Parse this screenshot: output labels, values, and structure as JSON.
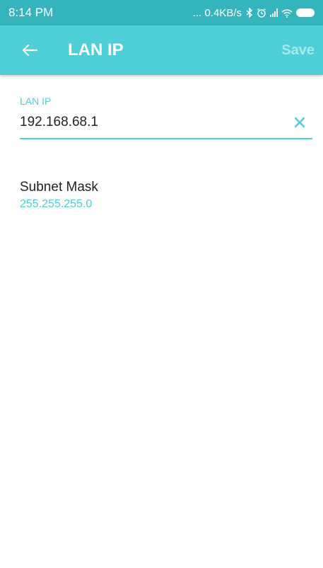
{
  "status_bar": {
    "time": "8:14 PM",
    "network_speed": "... 0.4KB/s",
    "icons": [
      "bluetooth-icon",
      "alarm-icon",
      "signal-icon",
      "wifi-icon",
      "battery-icon"
    ]
  },
  "toolbar": {
    "title": "LAN IP",
    "save_label": "Save",
    "back_icon": "arrow-left-icon"
  },
  "lan_ip_field": {
    "label": "LAN IP",
    "value": "192.168.68.1",
    "clear_icon": "close-icon"
  },
  "subnet_mask": {
    "label": "Subnet Mask",
    "value": "255.255.255.0"
  },
  "colors": {
    "status_bar": "#35b4bd",
    "toolbar": "#4ecfd8",
    "accent": "#4ecfd8",
    "save_disabled": "#a9e8ec"
  }
}
